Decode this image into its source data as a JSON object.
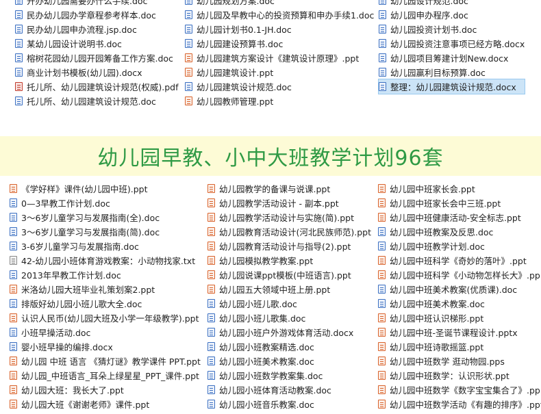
{
  "top_columns": [
    {
      "items": [
        {
          "name": "开办幼儿园需要办什么手续.doc",
          "type": "doc"
        },
        {
          "name": "民办幼儿园办学章程参考样本.doc",
          "type": "doc"
        },
        {
          "name": "民办幼儿园申办流程.jsp.doc",
          "type": "doc"
        },
        {
          "name": "某幼儿园设计说明书.doc",
          "type": "doc"
        },
        {
          "name": "榕树花园幼儿园开园筹备工作方案.doc",
          "type": "doc"
        },
        {
          "name": "商业计划书模板(幼儿园).docx",
          "type": "doc"
        },
        {
          "name": "托儿所、幼儿园建筑设计规范(权威).pdf",
          "type": "pdf"
        },
        {
          "name": "托儿所、幼儿园建筑设计规范.doc",
          "type": "doc"
        }
      ]
    },
    {
      "items": [
        {
          "name": "幼儿园规划方案.doc",
          "type": "doc"
        },
        {
          "name": "幼儿园及早教中心的投资预算和申办手续1.doc",
          "type": "doc"
        },
        {
          "name": "幼儿园计划书0.1-JH.doc",
          "type": "doc"
        },
        {
          "name": "幼儿园建设预算书.doc",
          "type": "doc"
        },
        {
          "name": "幼儿园建筑方案设计《建筑设计原理》.ppt",
          "type": "ppt"
        },
        {
          "name": "幼儿园建筑设计.ppt",
          "type": "ppt"
        },
        {
          "name": "幼儿园建筑设计规范.doc",
          "type": "doc"
        },
        {
          "name": "幼儿园教师管理.ppt",
          "type": "ppt"
        }
      ]
    },
    {
      "items": [
        {
          "name": "幼儿园设计规范.doc",
          "type": "doc"
        },
        {
          "name": "幼儿园申办程序.doc",
          "type": "doc"
        },
        {
          "name": "幼儿园投资计划书.doc",
          "type": "doc"
        },
        {
          "name": "幼儿园投资注意事项已经方略.docx",
          "type": "doc"
        },
        {
          "name": "幼儿园项目筹建计划New.docx",
          "type": "doc"
        },
        {
          "name": "幼儿园赢利目标预算.doc",
          "type": "doc"
        },
        {
          "name": "整理：幼儿园建筑设计规范.docx",
          "type": "doc",
          "selected": true
        }
      ]
    }
  ],
  "banner": {
    "title": "幼儿园早教、小中大班教学计划96套"
  },
  "bottom_columns": [
    {
      "items": [
        {
          "name": "《学好样》课件(幼儿园中班).ppt",
          "type": "ppt"
        },
        {
          "name": "0—3早教工作计划.doc",
          "type": "doc"
        },
        {
          "name": "3～6岁儿童学习与发展指南(全).doc",
          "type": "doc"
        },
        {
          "name": "3～6岁儿童学习与发展指南(简).doc",
          "type": "doc"
        },
        {
          "name": "3-6岁儿童学习与发展指南.doc",
          "type": "doc"
        },
        {
          "name": "42-幼儿园小班体育游戏教案：小动物找家.txt",
          "type": "txt"
        },
        {
          "name": "2013年早教工作计划.doc",
          "type": "doc"
        },
        {
          "name": "米洛幼儿园大班毕业礼策划案2.ppt",
          "type": "ppt"
        },
        {
          "name": "排版好幼儿园小班儿歌大全.doc",
          "type": "doc"
        },
        {
          "name": "认识人民币(幼儿园大班及小学一年级教学).ppt",
          "type": "ppt"
        },
        {
          "name": "小班早操活动.doc",
          "type": "doc"
        },
        {
          "name": "婴小班早操的编排.docx",
          "type": "doc"
        },
        {
          "name": "幼儿园 中班 语言 《猜灯谜》教学课件 PPT.ppt",
          "type": "ppt"
        },
        {
          "name": "幼儿园_中班语言_耳朵上绿星星_PPT_课件.ppt",
          "type": "ppt"
        },
        {
          "name": "幼儿园大班：我长大了.ppt",
          "type": "ppt"
        },
        {
          "name": "幼儿园大班《谢谢老师》课件.ppt",
          "type": "ppt"
        }
      ]
    },
    {
      "items": [
        {
          "name": "幼儿园教学的备课与说课.ppt",
          "type": "ppt"
        },
        {
          "name": "幼儿园教学活动设计 - 副本.ppt",
          "type": "ppt"
        },
        {
          "name": "幼儿园教学活动设计与实施(简).ppt",
          "type": "ppt"
        },
        {
          "name": "幼儿园教育活动设计(河北民族师范).ppt",
          "type": "ppt"
        },
        {
          "name": "幼儿园教育活动设计与指导(2).ppt",
          "type": "ppt"
        },
        {
          "name": "幼儿园模拟教学教案.ppt",
          "type": "ppt"
        },
        {
          "name": "幼儿园说课ppt模板(中班语言).ppt",
          "type": "ppt"
        },
        {
          "name": "幼儿园五大领域中班上册.ppt",
          "type": "ppt"
        },
        {
          "name": "幼儿园小班儿歌.doc",
          "type": "doc"
        },
        {
          "name": "幼儿园小班儿歌集.doc",
          "type": "doc"
        },
        {
          "name": "幼儿园小班户外游戏体育活动.docx",
          "type": "doc"
        },
        {
          "name": "幼儿园小班教案精选.doc",
          "type": "doc"
        },
        {
          "name": "幼儿园小班美术教案.doc",
          "type": "doc"
        },
        {
          "name": "幼儿园小班数学教案集.doc",
          "type": "doc"
        },
        {
          "name": "幼儿园小班体育活动教案.doc",
          "type": "doc"
        },
        {
          "name": "幼儿园小班音乐教案.doc",
          "type": "doc"
        }
      ]
    },
    {
      "items": [
        {
          "name": "幼儿园中班家长会.ppt",
          "type": "ppt"
        },
        {
          "name": "幼儿园中班家长会中三班.ppt",
          "type": "ppt"
        },
        {
          "name": "幼儿园中班健康活动-安全标志.ppt",
          "type": "ppt"
        },
        {
          "name": "幼儿园中班教案及反思.doc",
          "type": "doc"
        },
        {
          "name": "幼儿园中班教学计划.doc",
          "type": "doc"
        },
        {
          "name": "幼儿园中班科学《奇妙的落叶》.ppt",
          "type": "ppt"
        },
        {
          "name": "幼儿园中班科学《小动物怎样长大》.pp",
          "type": "ppt"
        },
        {
          "name": "幼儿园中班美术教案(优质课).doc",
          "type": "doc"
        },
        {
          "name": "幼儿园中班美术教案.doc",
          "type": "doc"
        },
        {
          "name": "幼儿园中班认识梯形.ppt",
          "type": "ppt"
        },
        {
          "name": "幼儿园中班-圣诞节课程设计.pptx",
          "type": "ppt"
        },
        {
          "name": "幼儿园中班诗歌摇篮.ppt",
          "type": "ppt"
        },
        {
          "name": "幼儿园中班数学 逛动物园.pps",
          "type": "ppt"
        },
        {
          "name": "幼儿园中班数学：认识形状.ppt",
          "type": "ppt"
        },
        {
          "name": "幼儿园中班数学《数字宝宝集合了》.pp",
          "type": "ppt"
        },
        {
          "name": "幼儿园中班数学活动《有趣的排序》.ppt",
          "type": "ppt"
        }
      ]
    }
  ]
}
